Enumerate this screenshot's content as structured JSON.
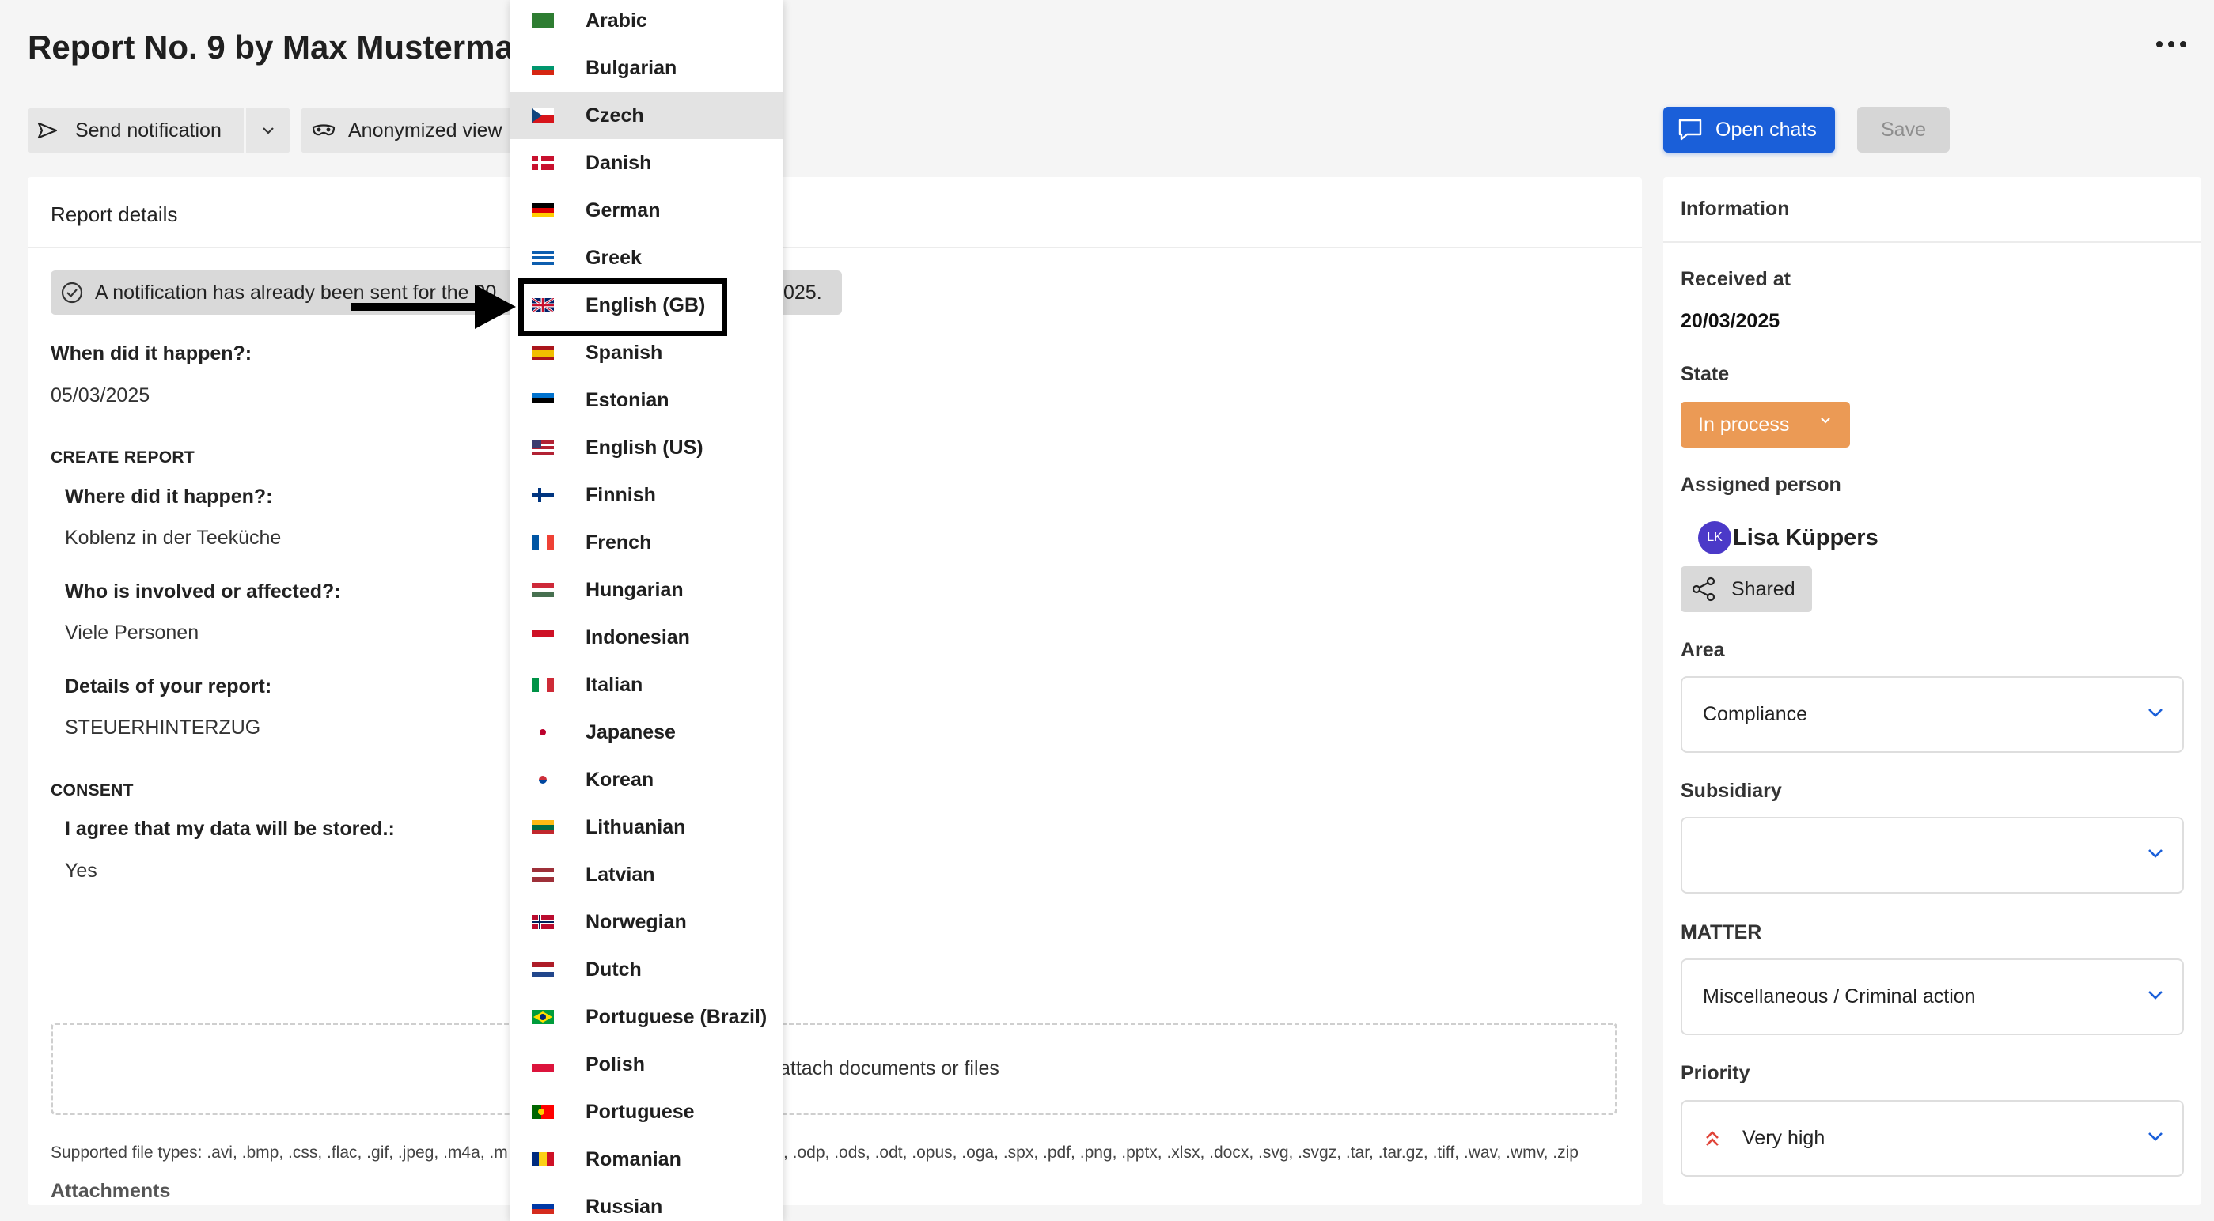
{
  "header": {
    "title": "Report No. 9 by Max Mustermann"
  },
  "toolbar": {
    "send_notification": "Send notification",
    "anonymized_view": "Anonymized view",
    "open_chats": "Open chats",
    "save": "Save"
  },
  "report": {
    "card_title": "Report details",
    "notice": "A notification has already been sent for the 20",
    "notice_tail": "025.",
    "when_label": "When did it happen?:",
    "when_value": "05/03/2025",
    "sections": [
      {
        "title": "CREATE REPORT",
        "fields": [
          {
            "label": "Where did it happen?:",
            "value": "Koblenz in der Teeküche"
          },
          {
            "label": "Who is involved or affected?:",
            "value": "Viele Personen"
          },
          {
            "label": "Details of your report:",
            "value": "STEUERHINTERZUG"
          }
        ]
      },
      {
        "title": "CONSENT",
        "fields": [
          {
            "label": "I agree that my data will be stored.:",
            "value": "Yes"
          }
        ]
      }
    ],
    "dropzone_text": "attach documents or files",
    "supported_prefix": "Supported file types: .avi, .bmp, .css, .flac, .gif, .jpeg, .m4a, .m",
    "supported_suffix": ", .odp, .ods, .odt, .opus, .oga, .spx, .pdf, .png, .pptx, .xlsx, .docx, .svg, .svgz, .tar, .tar.gz, .tiff, .wav, .wmv, .zip",
    "attachments_title": "Attachments"
  },
  "information": {
    "title": "Information",
    "received_label": "Received at",
    "received_value": "20/03/2025",
    "state_label": "State",
    "state_value": "In process",
    "assigned_label": "Assigned person",
    "avatar_initials": "LK",
    "assignee": "Lisa Küppers",
    "shared_label": "Shared",
    "area_label": "Area",
    "area_value": "Compliance",
    "subsidiary_label": "Subsidiary",
    "subsidiary_value": "",
    "matter_label": "MATTER",
    "matter_value": "Miscellaneous / Criminal action",
    "priority_label": "Priority",
    "priority_value": "Very high"
  },
  "colors": {
    "primary": "#1a5fd9",
    "state": "#eb9a55",
    "avatar": "#4b39c8",
    "priority_icon": "#e0453a"
  },
  "languages": [
    {
      "label": "Arabic",
      "flag": [
        "#2e7d32",
        "#2e7d32",
        "#2e7d32"
      ],
      "highlighted": false
    },
    {
      "label": "Bulgarian",
      "flag": [
        "#ffffff",
        "#00966e",
        "#d62612"
      ],
      "highlighted": false
    },
    {
      "label": "Czech",
      "flag": [
        "#ffffff",
        "#d7141a"
      ],
      "special": "czech",
      "highlighted": true
    },
    {
      "label": "Danish",
      "flag": [
        "#c8102e"
      ],
      "special": "nordic-white",
      "highlighted": false
    },
    {
      "label": "German",
      "flag": [
        "#000000",
        "#dd0000",
        "#ffce00"
      ],
      "highlighted": false
    },
    {
      "label": "Greek",
      "flag": [
        "#0d5eaf",
        "#ffffff",
        "#0d5eaf",
        "#ffffff",
        "#0d5eaf"
      ],
      "highlighted": false
    },
    {
      "label": "English (GB)",
      "flag": [
        "#012169"
      ],
      "special": "uk",
      "highlighted": false
    },
    {
      "label": "Spanish",
      "flag": [
        "#aa151b",
        "#f1bf00",
        "#f1bf00",
        "#aa151b"
      ],
      "highlighted": false
    },
    {
      "label": "Estonian",
      "flag": [
        "#0072ce",
        "#000000",
        "#ffffff"
      ],
      "highlighted": false
    },
    {
      "label": "English (US)",
      "flag": [
        "#b22234",
        "#ffffff",
        "#b22234",
        "#ffffff",
        "#b22234"
      ],
      "special": "us",
      "highlighted": false
    },
    {
      "label": "Finnish",
      "flag": [
        "#ffffff"
      ],
      "special": "nordic-blue",
      "highlighted": false
    },
    {
      "label": "French",
      "flag": [
        "#0055a4",
        "#ffffff",
        "#ef4135"
      ],
      "vertical": true,
      "highlighted": false
    },
    {
      "label": "Hungarian",
      "flag": [
        "#ce2939",
        "#ffffff",
        "#477050"
      ],
      "highlighted": false
    },
    {
      "label": "Indonesian",
      "flag": [
        "#ce1126",
        "#ffffff"
      ],
      "highlighted": false
    },
    {
      "label": "Italian",
      "flag": [
        "#009246",
        "#ffffff",
        "#ce2b37"
      ],
      "vertical": true,
      "highlighted": false
    },
    {
      "label": "Japanese",
      "flag": [
        "#ffffff"
      ],
      "special": "japan",
      "highlighted": false
    },
    {
      "label": "Korean",
      "flag": [
        "#ffffff"
      ],
      "special": "korea",
      "highlighted": false
    },
    {
      "label": "Lithuanian",
      "flag": [
        "#fdb913",
        "#006a44",
        "#c1272d"
      ],
      "highlighted": false
    },
    {
      "label": "Latvian",
      "flag": [
        "#9e3039",
        "#ffffff",
        "#9e3039"
      ],
      "highlighted": false
    },
    {
      "label": "Norwegian",
      "flag": [
        "#ba0c2f"
      ],
      "special": "norway",
      "highlighted": false
    },
    {
      "label": "Dutch",
      "flag": [
        "#ae1c28",
        "#ffffff",
        "#21468b"
      ],
      "highlighted": false
    },
    {
      "label": "Portuguese (Brazil)",
      "flag": [
        "#009c3b"
      ],
      "special": "brazil",
      "highlighted": false
    },
    {
      "label": "Polish",
      "flag": [
        "#ffffff",
        "#dc143c"
      ],
      "highlighted": false
    },
    {
      "label": "Portuguese",
      "flag": [
        "#006600",
        "#ff0000"
      ],
      "vertical": true,
      "special": "portugal",
      "highlighted": false
    },
    {
      "label": "Romanian",
      "flag": [
        "#002b7f",
        "#fcd116",
        "#ce1126"
      ],
      "vertical": true,
      "highlighted": false
    },
    {
      "label": "Russian",
      "flag": [
        "#ffffff",
        "#0039a6",
        "#d52b1e"
      ],
      "highlighted": false
    }
  ]
}
